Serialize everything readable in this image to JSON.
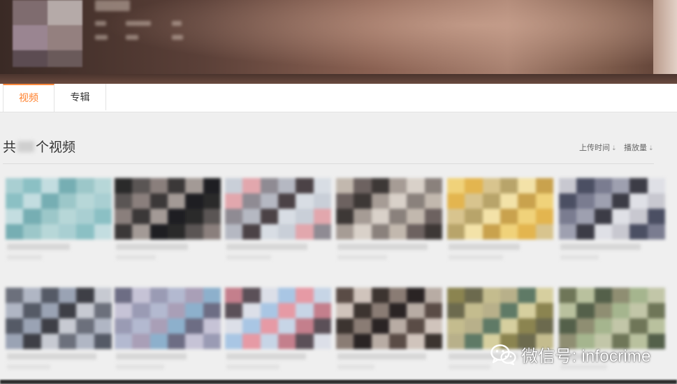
{
  "tabs": [
    {
      "label": "视频",
      "active": true
    },
    {
      "label": "专辑",
      "active": false
    }
  ],
  "section": {
    "count_prefix": "共",
    "count_suffix": "个视频"
  },
  "sort": {
    "upload_time": "上传时间",
    "play_count": "播放量",
    "arrow": "⇣"
  },
  "watermark": {
    "icon": "wechat-icon",
    "text": "微信号: infocrime"
  },
  "colors": {
    "accent": "#ff7f2a",
    "background": "#efefef"
  }
}
